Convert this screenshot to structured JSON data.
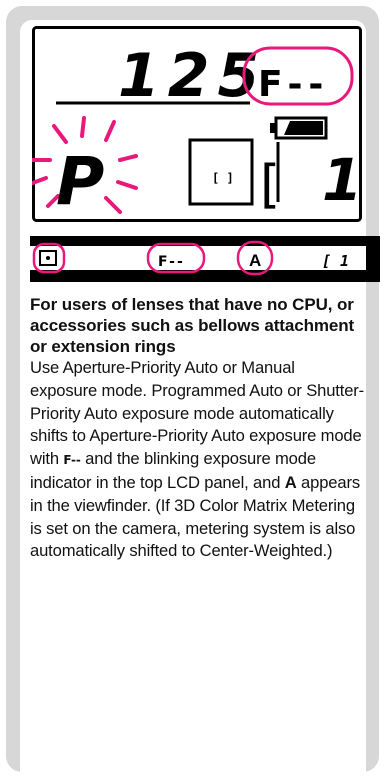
{
  "lcd": {
    "shutter_value": "125",
    "aperture_value": "F--",
    "mode_indicator": "P",
    "frame_counter": "1",
    "bracket_left": "[",
    "area_indicator": "[ ]"
  },
  "viewfinder": {
    "metering_symbol": "(•)",
    "aperture_value": "F--",
    "mode_value": "A",
    "bracket_counter": "[ 1"
  },
  "text": {
    "heading": "For users of lenses that have no CPU, or accessories such as bellows attachment or extension rings",
    "body_part1": "Use Aperture-Priority Auto or Manual exposure mode. Programmed Auto or Shutter-Priority Auto exposure mode automatically shifts to Aperture-Priority Auto exposure mode with ",
    "inline_symbol": "F--",
    "body_part2": " and the blinking exposure mode indicator in the top LCD panel, and ",
    "bold_letter": "A",
    "body_part3": " appears in the viewfinder. (If 3D Color Matrix Metering is set on the camera, metering system is also automatically shifted to Center-Weighted.)"
  },
  "colors": {
    "panel_bg": "#d7d7d7",
    "highlight": "#e8197a",
    "lcd_ink": "#000000"
  }
}
